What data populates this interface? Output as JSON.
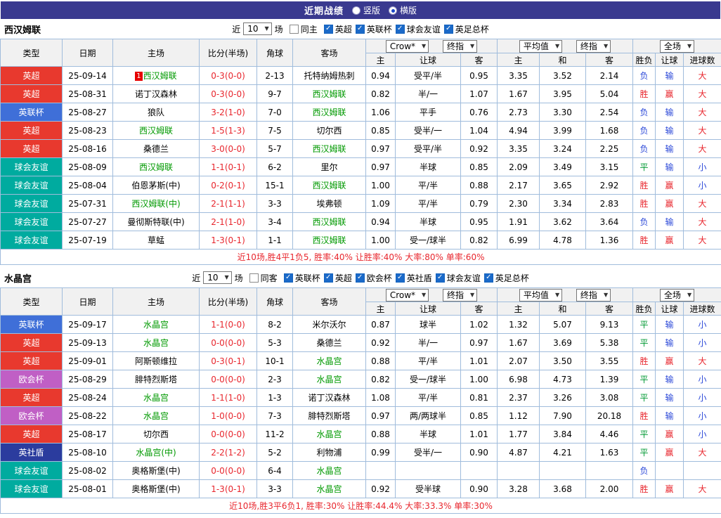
{
  "topbar": {
    "title": "近期战绩",
    "radios": [
      {
        "label": "竖版",
        "selected": false
      },
      {
        "label": "横版",
        "selected": true
      }
    ]
  },
  "type_colors": {
    "英超": "#e8392e",
    "英联杯": "#3f6fd8",
    "球会友谊": "#00ab9f",
    "欧会杯": "#c05fc5",
    "英社盾": "#2b3c9e"
  },
  "result_colors": {
    "胜": "#e8262d",
    "平": "#009933",
    "负": "#2b48d8",
    "赢": "#e8262d",
    "输": "#2b48d8",
    "大": "#e8262d",
    "小": "#2b48d8"
  },
  "header": {
    "cols": [
      "类型",
      "日期",
      "主场",
      "比分(半场)",
      "角球",
      "客场"
    ],
    "select_odds": "Crow*",
    "select_final1": "终指",
    "select_avg": "平均值",
    "select_final2": "终指",
    "select_scope": "全场",
    "sub_cols_odds": [
      "主",
      "让球",
      "客"
    ],
    "sub_cols_avg": [
      "主",
      "和",
      "客"
    ],
    "sub_cols_result": [
      "胜负",
      "让球",
      "进球数"
    ]
  },
  "sections": [
    {
      "team": "西汉姆联",
      "filter": {
        "near": "近",
        "count": "10",
        "games": "场",
        "same": {
          "label": "同主",
          "checked": false
        },
        "leagues": [
          {
            "label": "英超",
            "checked": true
          },
          {
            "label": "英联杯",
            "checked": true
          },
          {
            "label": "球会友谊",
            "checked": true
          },
          {
            "label": "英足总杯",
            "checked": true
          }
        ]
      },
      "rows": [
        {
          "type": "英超",
          "date": "25-09-14",
          "home": "西汉姆联",
          "home_focus": true,
          "home_badge": "1",
          "score": "0-3(0-0)",
          "corner": "2-13",
          "away": "托特纳姆热刺",
          "away_focus": false,
          "odds_home": "0.94",
          "handicap": "受平/半",
          "odds_away": "0.95",
          "avg_home": "3.35",
          "avg_draw": "3.52",
          "avg_away": "2.14",
          "result_wdl": "负",
          "result_handicap": "输",
          "result_goals": "大"
        },
        {
          "type": "英超",
          "date": "25-08-31",
          "home": "诺丁汉森林",
          "home_focus": false,
          "score": "0-3(0-0)",
          "corner": "9-7",
          "away": "西汉姆联",
          "away_focus": true,
          "odds_home": "0.82",
          "handicap": "半/一",
          "odds_away": "1.07",
          "avg_home": "1.67",
          "avg_draw": "3.95",
          "avg_away": "5.04",
          "result_wdl": "胜",
          "result_handicap": "赢",
          "result_goals": "大"
        },
        {
          "type": "英联杯",
          "date": "25-08-27",
          "home": "狼队",
          "home_focus": false,
          "score": "3-2(1-0)",
          "corner": "7-0",
          "away": "西汉姆联",
          "away_focus": true,
          "odds_home": "1.06",
          "handicap": "平手",
          "odds_away": "0.76",
          "avg_home": "2.73",
          "avg_draw": "3.30",
          "avg_away": "2.54",
          "result_wdl": "负",
          "result_handicap": "输",
          "result_goals": "大"
        },
        {
          "type": "英超",
          "date": "25-08-23",
          "home": "西汉姆联",
          "home_focus": true,
          "score": "1-5(1-3)",
          "corner": "7-5",
          "away": "切尔西",
          "away_focus": false,
          "odds_home": "0.85",
          "handicap": "受半/一",
          "odds_away": "1.04",
          "avg_home": "4.94",
          "avg_draw": "3.99",
          "avg_away": "1.68",
          "result_wdl": "负",
          "result_handicap": "输",
          "result_goals": "大"
        },
        {
          "type": "英超",
          "date": "25-08-16",
          "home": "桑德兰",
          "home_focus": false,
          "score": "3-0(0-0)",
          "corner": "5-7",
          "away": "西汉姆联",
          "away_focus": true,
          "odds_home": "0.97",
          "handicap": "受平/半",
          "odds_away": "0.92",
          "avg_home": "3.35",
          "avg_draw": "3.24",
          "avg_away": "2.25",
          "result_wdl": "负",
          "result_handicap": "输",
          "result_goals": "大"
        },
        {
          "type": "球会友谊",
          "date": "25-08-09",
          "home": "西汉姆联",
          "home_focus": true,
          "score": "1-1(0-1)",
          "corner": "6-2",
          "away": "里尔",
          "away_focus": false,
          "odds_home": "0.97",
          "handicap": "半球",
          "odds_away": "0.85",
          "avg_home": "2.09",
          "avg_draw": "3.49",
          "avg_away": "3.15",
          "result_wdl": "平",
          "result_handicap": "输",
          "result_goals": "小"
        },
        {
          "type": "球会友谊",
          "date": "25-08-04",
          "home": "伯恩茅斯(中)",
          "home_focus": false,
          "score": "0-2(0-1)",
          "corner": "15-1",
          "away": "西汉姆联",
          "away_focus": true,
          "odds_home": "1.00",
          "handicap": "平/半",
          "odds_away": "0.88",
          "avg_home": "2.17",
          "avg_draw": "3.65",
          "avg_away": "2.92",
          "result_wdl": "胜",
          "result_handicap": "赢",
          "result_goals": "小"
        },
        {
          "type": "球会友谊",
          "date": "25-07-31",
          "home": "西汉姆联(中)",
          "home_focus": true,
          "score": "2-1(1-1)",
          "corner": "3-3",
          "away": "埃弗顿",
          "away_focus": false,
          "odds_home": "1.09",
          "handicap": "平/半",
          "odds_away": "0.79",
          "avg_home": "2.30",
          "avg_draw": "3.34",
          "avg_away": "2.83",
          "result_wdl": "胜",
          "result_handicap": "赢",
          "result_goals": "大"
        },
        {
          "type": "球会友谊",
          "date": "25-07-27",
          "home": "曼彻斯特联(中)",
          "home_focus": false,
          "score": "2-1(1-0)",
          "corner": "3-4",
          "away": "西汉姆联",
          "away_focus": true,
          "odds_home": "0.94",
          "handicap": "半球",
          "odds_away": "0.95",
          "avg_home": "1.91",
          "avg_draw": "3.62",
          "avg_away": "3.64",
          "result_wdl": "负",
          "result_handicap": "输",
          "result_goals": "大"
        },
        {
          "type": "球会友谊",
          "date": "25-07-19",
          "home": "草蜢",
          "home_focus": false,
          "score": "1-3(0-1)",
          "corner": "1-1",
          "away": "西汉姆联",
          "away_focus": true,
          "odds_home": "1.00",
          "handicap": "受一/球半",
          "odds_away": "0.82",
          "avg_home": "6.99",
          "avg_draw": "4.78",
          "avg_away": "1.36",
          "result_wdl": "胜",
          "result_handicap": "赢",
          "result_goals": "大"
        }
      ],
      "summary": "近10场,胜4平1负5, 胜率:40% 让胜率:40% 大率:80% 单率:60%"
    },
    {
      "team": "水晶宫",
      "filter": {
        "near": "近",
        "count": "10",
        "games": "场",
        "same": {
          "label": "同客",
          "checked": false
        },
        "leagues": [
          {
            "label": "英联杯",
            "checked": true
          },
          {
            "label": "英超",
            "checked": true
          },
          {
            "label": "欧会杯",
            "checked": true
          },
          {
            "label": "英社盾",
            "checked": true
          },
          {
            "label": "球会友谊",
            "checked": true
          },
          {
            "label": "英足总杯",
            "checked": true
          }
        ]
      },
      "rows": [
        {
          "type": "英联杯",
          "date": "25-09-17",
          "home": "水晶宫",
          "home_focus": true,
          "score": "1-1(0-0)",
          "corner": "8-2",
          "away": "米尔沃尔",
          "away_focus": false,
          "odds_home": "0.87",
          "handicap": "球半",
          "odds_away": "1.02",
          "avg_home": "1.32",
          "avg_draw": "5.07",
          "avg_away": "9.13",
          "result_wdl": "平",
          "result_handicap": "输",
          "result_goals": "小"
        },
        {
          "type": "英超",
          "date": "25-09-13",
          "home": "水晶宫",
          "home_focus": true,
          "score": "0-0(0-0)",
          "corner": "5-3",
          "away": "桑德兰",
          "away_focus": false,
          "odds_home": "0.92",
          "handicap": "半/一",
          "odds_away": "0.97",
          "avg_home": "1.67",
          "avg_draw": "3.69",
          "avg_away": "5.38",
          "result_wdl": "平",
          "result_handicap": "输",
          "result_goals": "小"
        },
        {
          "type": "英超",
          "date": "25-09-01",
          "home": "阿斯顿维拉",
          "home_focus": false,
          "score": "0-3(0-1)",
          "corner": "10-1",
          "away": "水晶宫",
          "away_focus": true,
          "odds_home": "0.88",
          "handicap": "平/半",
          "odds_away": "1.01",
          "avg_home": "2.07",
          "avg_draw": "3.50",
          "avg_away": "3.55",
          "result_wdl": "胜",
          "result_handicap": "赢",
          "result_goals": "大"
        },
        {
          "type": "欧会杯",
          "date": "25-08-29",
          "home": "腓特烈斯塔",
          "home_focus": false,
          "score": "0-0(0-0)",
          "corner": "2-3",
          "away": "水晶宫",
          "away_focus": true,
          "odds_home": "0.82",
          "handicap": "受一/球半",
          "odds_away": "1.00",
          "avg_home": "6.98",
          "avg_draw": "4.73",
          "avg_away": "1.39",
          "result_wdl": "平",
          "result_handicap": "输",
          "result_goals": "小"
        },
        {
          "type": "英超",
          "date": "25-08-24",
          "home": "水晶宫",
          "home_focus": true,
          "score": "1-1(1-0)",
          "corner": "1-3",
          "away": "诺丁汉森林",
          "away_focus": false,
          "odds_home": "1.08",
          "handicap": "平/半",
          "odds_away": "0.81",
          "avg_home": "2.37",
          "avg_draw": "3.26",
          "avg_away": "3.08",
          "result_wdl": "平",
          "result_handicap": "输",
          "result_goals": "小"
        },
        {
          "type": "欧会杯",
          "date": "25-08-22",
          "home": "水晶宫",
          "home_focus": true,
          "score": "1-0(0-0)",
          "corner": "7-3",
          "away": "腓特烈斯塔",
          "away_focus": false,
          "odds_home": "0.97",
          "handicap": "两/两球半",
          "odds_away": "0.85",
          "avg_home": "1.12",
          "avg_draw": "7.90",
          "avg_away": "20.18",
          "result_wdl": "胜",
          "result_handicap": "输",
          "result_goals": "小"
        },
        {
          "type": "英超",
          "date": "25-08-17",
          "home": "切尔西",
          "home_focus": false,
          "score": "0-0(0-0)",
          "corner": "11-2",
          "away": "水晶宫",
          "away_focus": true,
          "odds_home": "0.88",
          "handicap": "半球",
          "odds_away": "1.01",
          "avg_home": "1.77",
          "avg_draw": "3.84",
          "avg_away": "4.46",
          "result_wdl": "平",
          "result_handicap": "赢",
          "result_goals": "小"
        },
        {
          "type": "英社盾",
          "date": "25-08-10",
          "home": "水晶宫(中)",
          "home_focus": true,
          "score": "2-2(1-2)",
          "corner": "5-2",
          "away": "利物浦",
          "away_focus": false,
          "odds_home": "0.99",
          "handicap": "受半/一",
          "odds_away": "0.90",
          "avg_home": "4.87",
          "avg_draw": "4.21",
          "avg_away": "1.63",
          "result_wdl": "平",
          "result_handicap": "赢",
          "result_goals": "大"
        },
        {
          "type": "球会友谊",
          "date": "25-08-02",
          "home": "奥格斯堡(中)",
          "home_focus": false,
          "score": "0-0(0-0)",
          "corner": "6-4",
          "away": "水晶宫",
          "away_focus": true,
          "odds_home": "",
          "handicap": "",
          "odds_away": "",
          "avg_home": "",
          "avg_draw": "",
          "avg_away": "",
          "result_wdl": "负",
          "result_handicap": "",
          "result_goals": ""
        },
        {
          "type": "球会友谊",
          "date": "25-08-01",
          "home": "奥格斯堡(中)",
          "home_focus": false,
          "score": "1-3(0-1)",
          "corner": "3-3",
          "away": "水晶宫",
          "away_focus": true,
          "odds_home": "0.92",
          "handicap": "受半球",
          "odds_away": "0.90",
          "avg_home": "3.28",
          "avg_draw": "3.68",
          "avg_away": "2.00",
          "result_wdl": "胜",
          "result_handicap": "赢",
          "result_goals": "大"
        }
      ],
      "summary": "近10场,胜3平6负1, 胜率:30% 让胜率:44.4% 大率:33.3% 单率:30%"
    }
  ]
}
